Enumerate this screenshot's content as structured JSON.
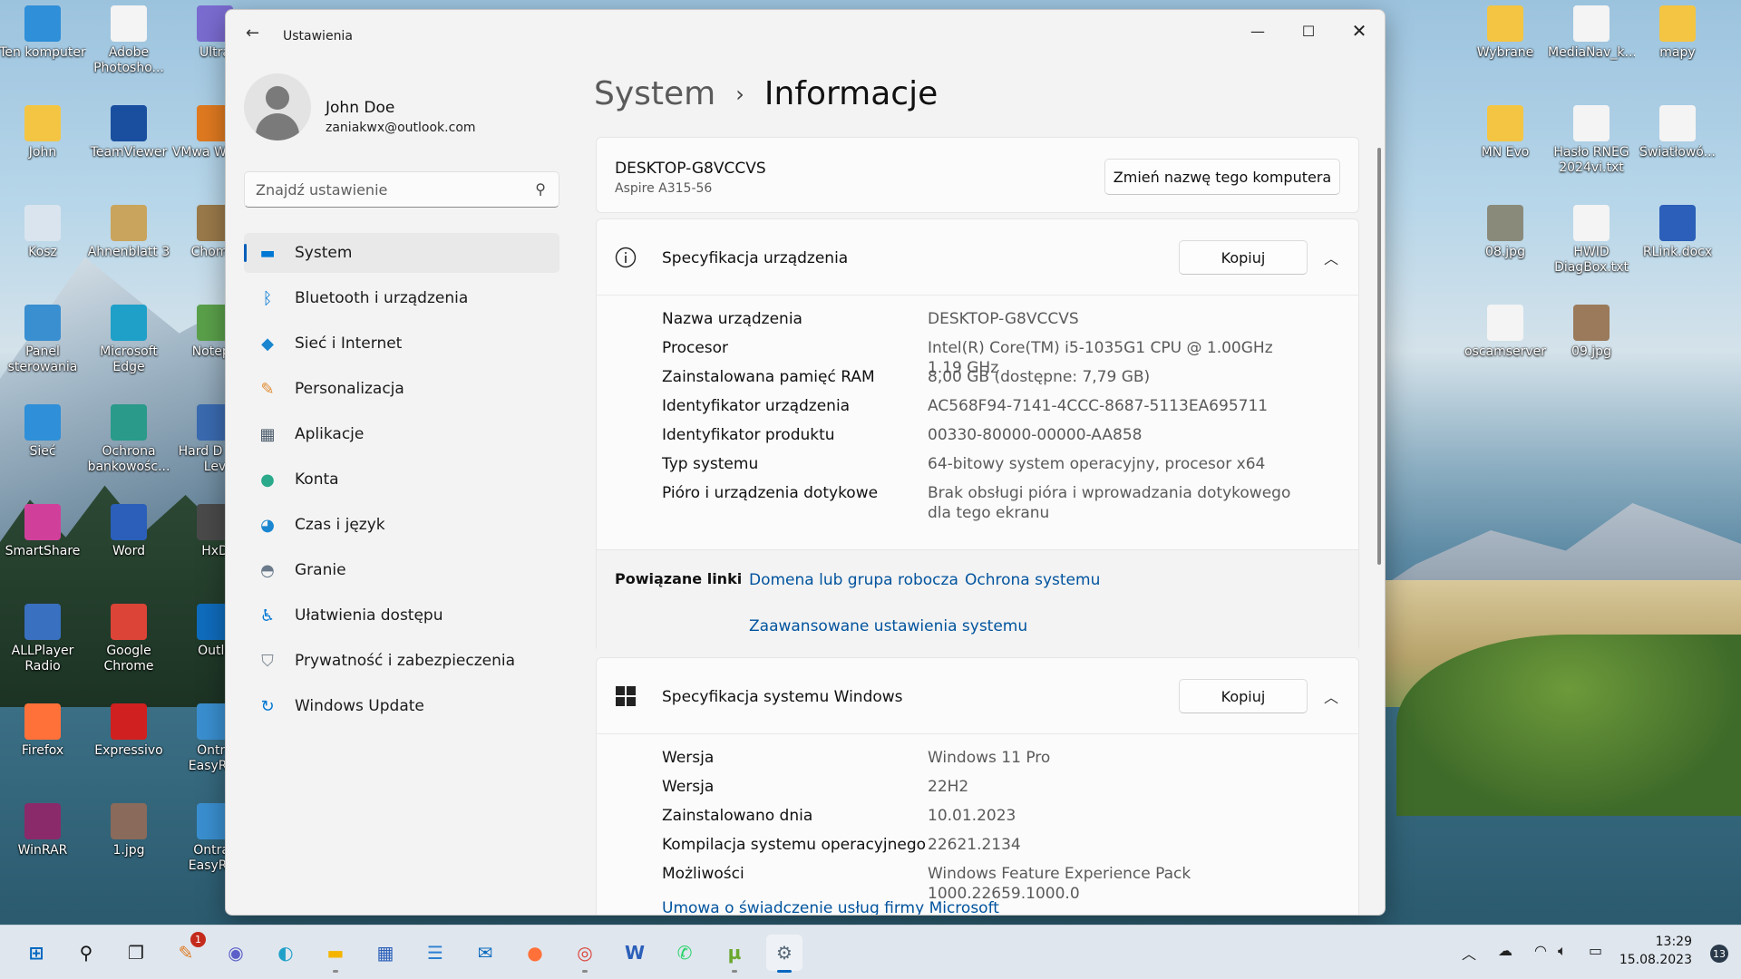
{
  "desktop": {
    "icons_left": [
      {
        "label": "Ten komputer",
        "icon": "monitor-icon",
        "color": "#2f8fd8"
      },
      {
        "label": "Adobe Photosho...",
        "icon": "document-icon",
        "color": "#f4f4f4"
      },
      {
        "label": "Ultra",
        "icon": "disc-icon",
        "color": "#7a6bd0"
      },
      {
        "label": "John",
        "icon": "folder-icon",
        "color": "#f4c542"
      },
      {
        "label": "TeamViewer",
        "icon": "teamviewer-icon",
        "color": "#1a4fa0"
      },
      {
        "label": "VMwa Workst",
        "icon": "vmware-icon",
        "color": "#e07a20"
      },
      {
        "label": "Kosz",
        "icon": "recycle-bin-icon",
        "color": "#d9e4ee"
      },
      {
        "label": "Ahnenblatt 3",
        "icon": "ahnenblatt-icon",
        "color": "#c9a45c"
      },
      {
        "label": "Chomik",
        "icon": "chomik-icon",
        "color": "#9a7a4a"
      },
      {
        "label": "Panel sterowania",
        "icon": "control-panel-icon",
        "color": "#3a8fd0"
      },
      {
        "label": "Microsoft Edge",
        "icon": "edge-icon",
        "color": "#1fa0c8"
      },
      {
        "label": "Notepa",
        "icon": "notepad-icon",
        "color": "#5aa04a"
      },
      {
        "label": "Sieć",
        "icon": "network-icon",
        "color": "#2f8fd8"
      },
      {
        "label": "Ochrona bankowośc...",
        "icon": "shield-icon",
        "color": "#2a9a8a"
      },
      {
        "label": "Hard D Low Lev",
        "icon": "disk-tool-icon",
        "color": "#3a6ab0"
      },
      {
        "label": "SmartShare",
        "icon": "smartshare-icon",
        "color": "#d0409a"
      },
      {
        "label": "Word",
        "icon": "word-icon",
        "color": "#2b5fb9"
      },
      {
        "label": "HxD",
        "icon": "hxd-icon",
        "color": "#4a4a4a"
      },
      {
        "label": "ALLPlayer Radio",
        "icon": "allplayer-icon",
        "color": "#3a70c0"
      },
      {
        "label": "Google Chrome",
        "icon": "chrome-icon",
        "color": "#db4437"
      },
      {
        "label": "Outlo",
        "icon": "outlook-icon",
        "color": "#0f6cbd"
      },
      {
        "label": "Firefox",
        "icon": "firefox-icon",
        "color": "#ff7139"
      },
      {
        "label": "Expressivo",
        "icon": "expressivo-icon",
        "color": "#d02020"
      },
      {
        "label": "Ontra EasyRec",
        "icon": "easyrecovery-icon",
        "color": "#3a8fd0"
      },
      {
        "label": "WinRAR",
        "icon": "winrar-icon",
        "color": "#8a2a6a"
      },
      {
        "label": "1.jpg",
        "icon": "image-icon",
        "color": "#8a6a5a"
      },
      {
        "label": "Ontrac EasyRec",
        "icon": "easyrecovery-icon",
        "color": "#3a8fd0"
      }
    ],
    "icons_right": [
      {
        "label": "Wybrane",
        "icon": "folder-icon",
        "color": "#f4c542"
      },
      {
        "label": "MediaNav_k...",
        "icon": "document-icon",
        "color": "#f4f4f4"
      },
      {
        "label": "mapy",
        "icon": "folder-icon",
        "color": "#f4c542"
      },
      {
        "label": "MN Evo",
        "icon": "folder-icon",
        "color": "#f4c542"
      },
      {
        "label": "Hasło RNEG 2024vi.txt",
        "icon": "text-file-icon",
        "color": "#f4f4f4"
      },
      {
        "label": "Światłowó...",
        "icon": "text-file-icon",
        "color": "#f4f4f4"
      },
      {
        "label": "08.jpg",
        "icon": "image-icon",
        "color": "#8a8a7a"
      },
      {
        "label": "HWID DiagBox.txt",
        "icon": "text-file-icon",
        "color": "#f4f4f4"
      },
      {
        "label": "RLink.docx",
        "icon": "word-doc-icon",
        "color": "#2b5fb9"
      },
      {
        "label": "oscamserver",
        "icon": "text-file-icon",
        "color": "#f4f4f4"
      },
      {
        "label": "09.jpg",
        "icon": "image-icon",
        "color": "#9a7a5a"
      }
    ]
  },
  "window": {
    "title": "Ustawienia",
    "user": {
      "name": "John Doe",
      "email": "zaniakwx@outlook.com"
    },
    "search_placeholder": "Znajdź ustawienie",
    "nav": [
      {
        "label": "System",
        "icon": "system-icon",
        "color": "#0078d4",
        "active": true
      },
      {
        "label": "Bluetooth i urządzenia",
        "icon": "bluetooth-icon",
        "color": "#0078d4"
      },
      {
        "label": "Sieć i Internet",
        "icon": "wifi-icon",
        "color": "#1a86d0"
      },
      {
        "label": "Personalizacja",
        "icon": "brush-icon",
        "color": "#e08a30"
      },
      {
        "label": "Aplikacje",
        "icon": "apps-icon",
        "color": "#4a5a6a"
      },
      {
        "label": "Konta",
        "icon": "account-icon",
        "color": "#2aaa8a"
      },
      {
        "label": "Czas i język",
        "icon": "globe-clock-icon",
        "color": "#1a86d0"
      },
      {
        "label": "Granie",
        "icon": "gamepad-icon",
        "color": "#6a7a8a"
      },
      {
        "label": "Ułatwienia dostępu",
        "icon": "accessibility-icon",
        "color": "#0078d4"
      },
      {
        "label": "Prywatność i zabezpieczenia",
        "icon": "shield-gray-icon",
        "color": "#7a8590"
      },
      {
        "label": "Windows Update",
        "icon": "update-icon",
        "color": "#0078d4"
      }
    ],
    "breadcrumb": {
      "parent": "System",
      "separator": "›",
      "current": "Informacje"
    },
    "device": {
      "name": "DESKTOP-G8VCCVS",
      "model": "Aspire A315-56",
      "rename_label": "Zmień nazwę tego komputera"
    },
    "device_spec": {
      "title": "Specyfikacja urządzenia",
      "copy_label": "Kopiuj",
      "rows": [
        {
          "label": "Nazwa urządzenia",
          "value": "DESKTOP-G8VCCVS"
        },
        {
          "label": "Procesor",
          "value": "Intel(R) Core(TM) i5-1035G1 CPU @ 1.00GHz   1.19 GHz"
        },
        {
          "label": "Zainstalowana pamięć RAM",
          "value": "8,00 GB (dostępne: 7,79 GB)"
        },
        {
          "label": "Identyfikator urządzenia",
          "value": "AC568F94-7141-4CCC-8687-5113EA695711"
        },
        {
          "label": "Identyfikator produktu",
          "value": "00330-80000-00000-AA858"
        },
        {
          "label": "Typ systemu",
          "value": "64-bitowy system operacyjny, procesor x64"
        },
        {
          "label": "Pióro i urządzenia dotykowe",
          "value": "Brak obsługi pióra i wprowadzania dotykowego dla tego ekranu"
        }
      ]
    },
    "related": {
      "label": "Powiązane linki",
      "links": [
        "Domena lub grupa robocza",
        "Ochrona systemu",
        "Zaawansowane ustawienia systemu"
      ]
    },
    "windows_spec": {
      "title": "Specyfikacja systemu Windows",
      "copy_label": "Kopiuj",
      "rows": [
        {
          "label": "Wersja",
          "value": "Windows 11 Pro"
        },
        {
          "label": "Wersja",
          "value": "22H2"
        },
        {
          "label": "Zainstalowano dnia",
          "value": "10.01.2023"
        },
        {
          "label": "Kompilacja systemu operacyjnego",
          "value": "22621.2134"
        },
        {
          "label": "Możliwości",
          "value": "Windows Feature Experience Pack 1000.22659.1000.0"
        }
      ],
      "link": "Umowa o świadczenie usług firmy Microsoft"
    }
  },
  "taskbar": {
    "apps": [
      {
        "name": "start-button",
        "icon": "windows-logo-icon",
        "glyph": "⊞",
        "color": "#0067c0"
      },
      {
        "name": "search-button",
        "icon": "search-icon",
        "glyph": "⚲",
        "color": "#111"
      },
      {
        "name": "task-view-button",
        "icon": "task-view-icon",
        "glyph": "❐",
        "color": "#222"
      },
      {
        "name": "ccleaner-app",
        "icon": "broom-icon",
        "glyph": "✎",
        "color": "#e07a20",
        "badge": "1"
      },
      {
        "name": "chat-app",
        "icon": "chat-icon",
        "glyph": "◉",
        "color": "#5b5fc7"
      },
      {
        "name": "edge-app",
        "icon": "edge-icon",
        "glyph": "◐",
        "color": "#1fa0c8"
      },
      {
        "name": "explorer-app",
        "icon": "folder-icon",
        "glyph": "▬",
        "color": "#f4b400",
        "dot": true
      },
      {
        "name": "store-app",
        "icon": "store-icon",
        "glyph": "▦",
        "color": "#2b5fb9"
      },
      {
        "name": "notepad-app",
        "icon": "notepad-icon",
        "glyph": "☰",
        "color": "#2b7fd0"
      },
      {
        "name": "outlook-app",
        "icon": "outlook-icon",
        "glyph": "✉",
        "color": "#0f6cbd"
      },
      {
        "name": "firefox-app",
        "icon": "firefox-icon",
        "glyph": "●",
        "color": "#ff7139"
      },
      {
        "name": "chrome-app",
        "icon": "chrome-icon",
        "glyph": "◎",
        "color": "#db4437",
        "dot": true
      },
      {
        "name": "word-app",
        "icon": "word-icon",
        "glyph": "W",
        "color": "#2b5fb9"
      },
      {
        "name": "whatsapp-app",
        "icon": "whatsapp-icon",
        "glyph": "✆",
        "color": "#25d366"
      },
      {
        "name": "utorrent-app",
        "icon": "utorrent-icon",
        "glyph": "µ",
        "color": "#6aa830",
        "dot": true
      },
      {
        "name": "settings-app",
        "icon": "gear-icon",
        "glyph": "⚙",
        "color": "#5a6a7a",
        "active": true
      }
    ],
    "time": "13:29",
    "date": "15.08.2023",
    "notifications": "13"
  }
}
